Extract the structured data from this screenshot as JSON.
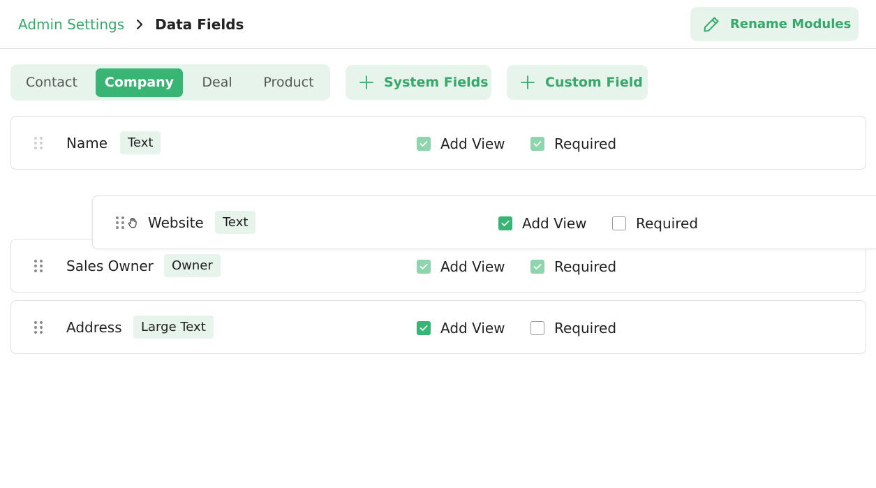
{
  "header": {
    "breadcrumb_root": "Admin Settings",
    "breadcrumb_current": "Data Fields",
    "rename_label": "Rename Modules"
  },
  "tabs": [
    {
      "label": "Contact",
      "active": false
    },
    {
      "label": "Company",
      "active": true
    },
    {
      "label": "Deal",
      "active": false
    },
    {
      "label": "Product",
      "active": false
    }
  ],
  "actions": {
    "system_fields_label": "System Fields",
    "custom_field_label": "Custom Field"
  },
  "fields": [
    {
      "name": "Name",
      "type": "Text",
      "add_view": true,
      "add_view_locked": true,
      "required": true,
      "required_locked": true
    },
    {
      "name": "Website",
      "type": "Text",
      "add_view": true,
      "add_view_locked": false,
      "required": false,
      "required_locked": false,
      "dragging": true
    },
    {
      "name": "Sales Owner",
      "type": "Owner",
      "add_view": true,
      "add_view_locked": true,
      "required": true,
      "required_locked": true
    },
    {
      "name": "Address",
      "type": "Large Text",
      "add_view": true,
      "add_view_locked": false,
      "required": false,
      "required_locked": false
    }
  ],
  "labels": {
    "add_view": "Add View",
    "required": "Required"
  },
  "colors": {
    "accent": "#38b474",
    "accent_text": "#36a86a",
    "accent_light": "#e6f4ec",
    "disabled_check": "#8ed5ad"
  }
}
